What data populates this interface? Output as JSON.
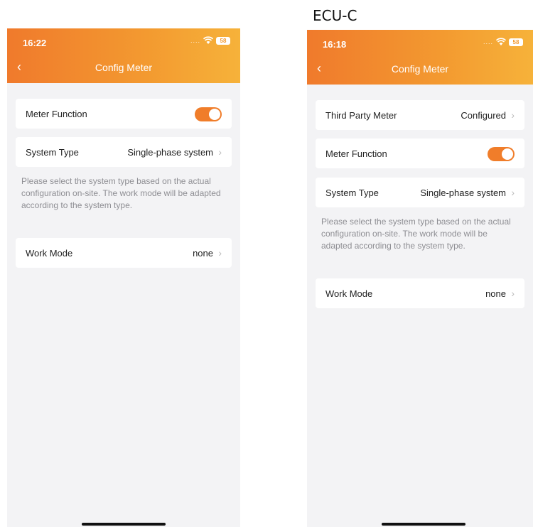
{
  "caption": "ECU-C",
  "left_screen": {
    "status": {
      "time": "16:22",
      "battery": "58"
    },
    "title": "Config Meter",
    "meter_function": {
      "label": "Meter Function",
      "enabled": true
    },
    "system_type": {
      "label": "System Type",
      "value": "Single-phase system"
    },
    "note": "Please select the system type based on the actual configuration on-site. The work mode will be adapted according to the system type.",
    "work_mode": {
      "label": "Work Mode",
      "value": "none"
    }
  },
  "right_screen": {
    "status": {
      "time": "16:18",
      "battery": "58"
    },
    "title": "Config Meter",
    "third_party_meter": {
      "label": "Third Party Meter",
      "value": "Configured"
    },
    "meter_function": {
      "label": "Meter Function",
      "enabled": true
    },
    "system_type": {
      "label": "System Type",
      "value": "Single-phase system"
    },
    "note": "Please select the system type based on the actual configuration on-site. The work mode will be adapted according to the system type.",
    "work_mode": {
      "label": "Work Mode",
      "value": "none"
    }
  },
  "colors": {
    "header_start": "#f07a2c",
    "header_end": "#f6b23a",
    "toggle_on": "#f07d2a",
    "background": "#f3f3f5"
  }
}
